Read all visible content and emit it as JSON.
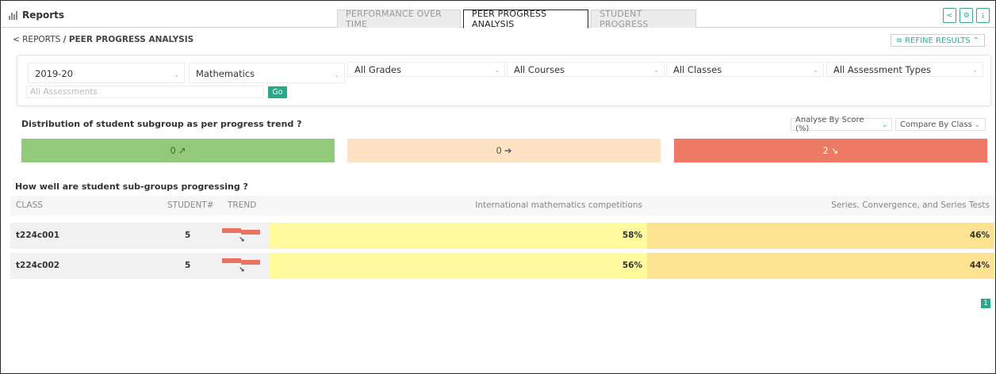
{
  "header": {
    "title": "Reports",
    "tabs": [
      {
        "label": "PERFORMANCE OVER TIME",
        "active": false
      },
      {
        "label": "PEER PROGRESS ANALYSIS",
        "active": true
      },
      {
        "label": "STUDENT PROGRESS",
        "active": false
      }
    ],
    "tools": {
      "share": "<",
      "settings": "⚙",
      "download": "⤓"
    }
  },
  "breadcrumb": {
    "root": "< REPORTS",
    "separator": "/",
    "current": "PEER PROGRESS ANALYSIS"
  },
  "refine": {
    "label": "REFINE RESULTS",
    "icon": "≡",
    "chevron": "⌃"
  },
  "filters": {
    "year": "2019-20",
    "subject": "Mathematics",
    "grades": "All Grades",
    "courses": "All Courses",
    "classes": "All Classes",
    "assessment_types": "All Assessment Types",
    "assessments_placeholder": "All Assessments",
    "go_label": "Go"
  },
  "distribution": {
    "title": "Distribution of student subgroup as per progress trend ?",
    "analyse_by": "Analyse By Score (%)",
    "compare_by": "Compare By Class",
    "trends": [
      {
        "count": "0",
        "arrow": "↗",
        "color": "#93c97b"
      },
      {
        "count": "0",
        "arrow": "➔",
        "color": "#fde3c4"
      },
      {
        "count": "2",
        "arrow": "↘",
        "color": "#ed7a65"
      }
    ]
  },
  "progress_table": {
    "title": "How well are student sub-groups progressing ?",
    "columns": [
      "CLASS",
      "STUDENT#",
      "TREND",
      "International mathematics competitions",
      "Series, Convergence, and Series Tests"
    ],
    "rows": [
      {
        "class": "t224c001",
        "students": "5",
        "trend": "↘",
        "score1": "58%",
        "score2": "46%"
      },
      {
        "class": "t224c002",
        "students": "5",
        "trend": "↘",
        "score1": "56%",
        "score2": "44%"
      }
    ]
  },
  "pagination": {
    "page": "1"
  }
}
